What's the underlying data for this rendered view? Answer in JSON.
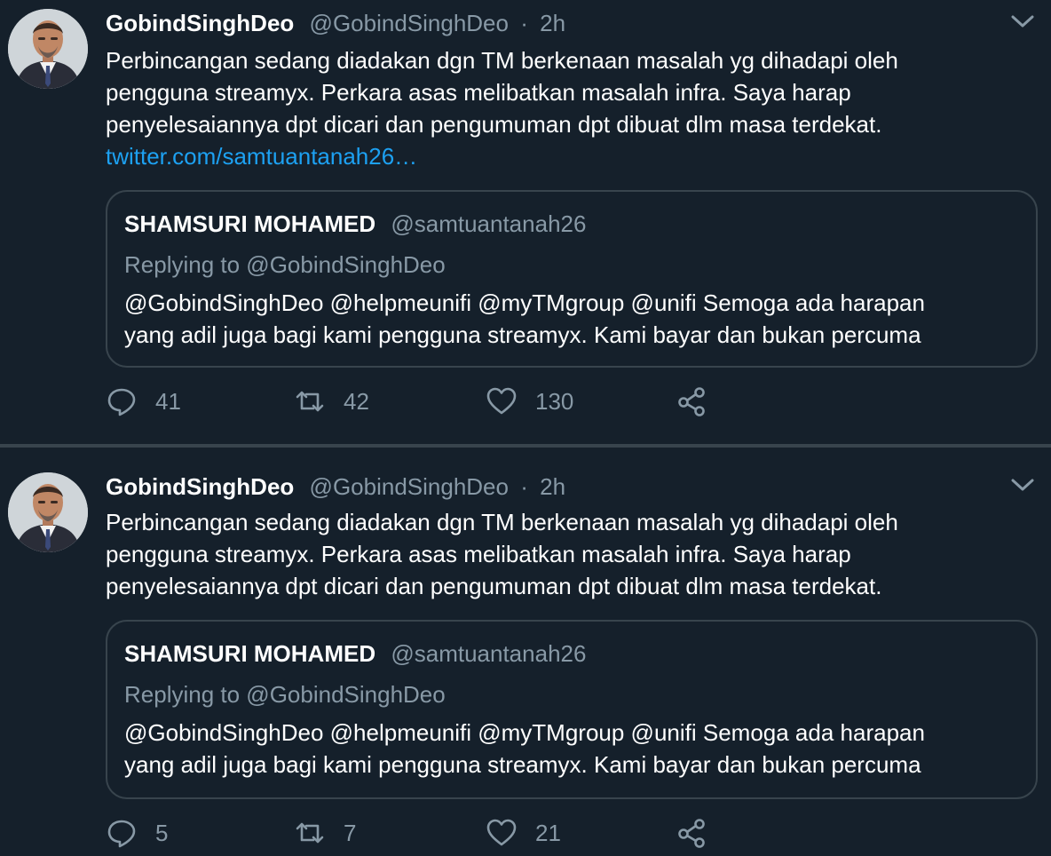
{
  "tweets": [
    {
      "author_name": "GobindSinghDeo",
      "handle": "@GobindSinghDeo",
      "separator": "·",
      "time": "2h",
      "text_lines": [
        "Perbincangan sedang diadakan dgn TM berkenaan masalah yg dihadapi oleh",
        "pengguna streamyx. Perkara asas melibatkan masalah infra. Saya harap",
        "penyelesaiannya dpt dicari dan pengumuman dpt dibuat dlm masa terdekat."
      ],
      "link": "twitter.com/samtuantanah26…",
      "quote": {
        "name": "SHAMSURI MOHAMED",
        "handle": "@samtuantanah26",
        "replying_to": "Replying to @GobindSinghDeo",
        "text_lines": [
          "@GobindSinghDeo @helpmeunifi @myTMgroup @unifi Semoga ada harapan",
          "yang adil juga bagi kami pengguna streamyx. Kami bayar dan bukan percuma"
        ]
      },
      "replies": "41",
      "retweets": "42",
      "likes": "130"
    },
    {
      "author_name": "GobindSinghDeo",
      "handle": "@GobindSinghDeo",
      "separator": "·",
      "time": "2h",
      "text_lines": [
        "Perbincangan sedang diadakan dgn TM berkenaan masalah yg dihadapi oleh",
        "pengguna streamyx. Perkara asas melibatkan masalah infra. Saya harap",
        "penyelesaiannya dpt dicari dan pengumuman dpt dibuat dlm masa terdekat."
      ],
      "quote": {
        "name": "SHAMSURI MOHAMED",
        "handle": "@samtuantanah26",
        "replying_to": "Replying to @GobindSinghDeo",
        "text_lines": [
          "@GobindSinghDeo @helpmeunifi @myTMgroup @unifi Semoga ada harapan",
          "yang adil juga bagi kami pengguna streamyx. Kami bayar dan bukan percuma"
        ]
      },
      "replies": "5",
      "retweets": "7",
      "likes": "21"
    }
  ],
  "icons": {
    "reply": "reply-icon",
    "retweet": "retweet-icon",
    "like": "heart-icon",
    "share": "share-icon",
    "caret": "chevron-down-icon",
    "avatar": "avatar"
  },
  "colors": {
    "background": "#15202b",
    "border": "#38444d",
    "secondary_text": "#8899a6",
    "link": "#1da1f2"
  }
}
